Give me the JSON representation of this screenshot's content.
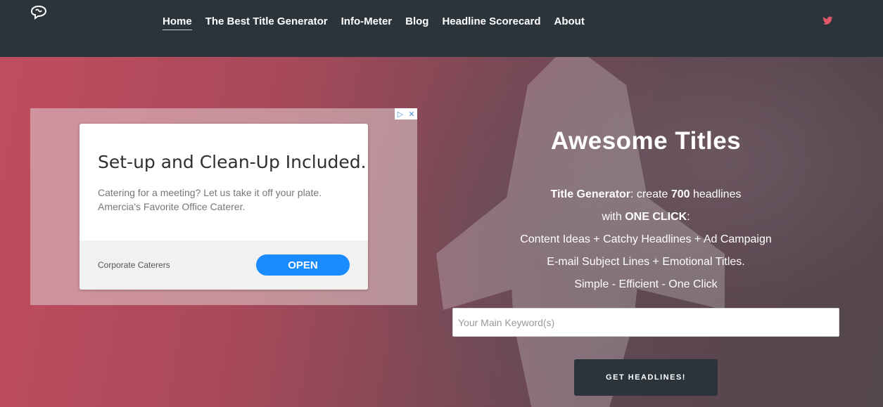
{
  "nav": {
    "items": [
      {
        "label": "Home",
        "active": true
      },
      {
        "label": "The Best Title Generator",
        "active": false
      },
      {
        "label": "Info-Meter",
        "active": false
      },
      {
        "label": "Blog",
        "active": false
      },
      {
        "label": "Headline Scorecard",
        "active": false
      },
      {
        "label": "About",
        "active": false
      }
    ],
    "social_icon": "twitter-icon",
    "logo_icon": "brain-logo-icon"
  },
  "ad": {
    "headline": "Set-up and Clean-Up Included.",
    "description": "Catering for a meeting? Let us take it off your plate. Amercia's Favorite Office Caterer.",
    "advertiser": "Corporate Caterers",
    "cta": "OPEN",
    "badge_icons": [
      "adchoices-icon",
      "close-icon"
    ]
  },
  "hero": {
    "title": "Awesome Titles",
    "line1_bold": "Title Generator",
    "line1_rest": ": create ",
    "line1_count": "700",
    "line1_tail": " headlines",
    "line2_pre": "with ",
    "line2_bold": "ONE CLICK",
    "line2_tail": ":",
    "line3": "Content Ideas + Catchy Headlines + Ad Campaign",
    "line4": "E-mail Subject Lines + Emotional Titles.",
    "line5": "Simple - Efficient - One Click"
  },
  "form": {
    "keyword_placeholder": "Your Main Keyword(s)",
    "keyword_value": "",
    "submit_label": "GET HEADLINES!"
  },
  "colors": {
    "navbar": "#2b343b",
    "twitter": "#e0566b",
    "ad_button": "#1a8cff",
    "hero_left": "#c04d5e",
    "hero_right": "#54464d"
  }
}
